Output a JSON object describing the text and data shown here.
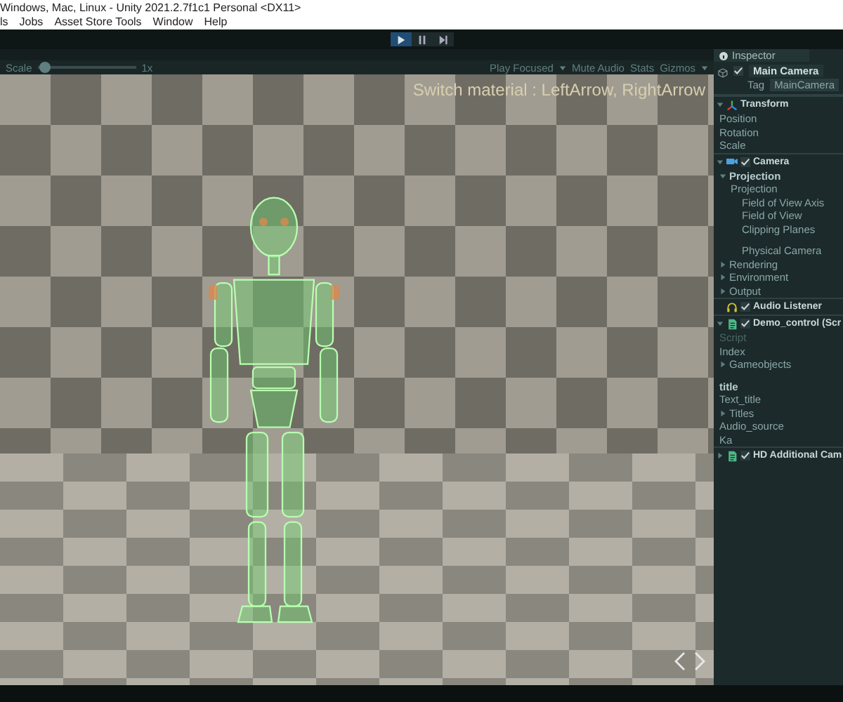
{
  "window": {
    "title": "Windows, Mac, Linux - Unity 2021.2.7f1c1 Personal <DX11>"
  },
  "menu": [
    "ls",
    "Jobs",
    "Asset Store Tools",
    "Window",
    "Help"
  ],
  "playback": [
    {
      "kind": "play",
      "selected": true
    },
    {
      "kind": "pause",
      "selected": false
    },
    {
      "kind": "step",
      "selected": false
    }
  ],
  "game_bar": {
    "scale_label": "Scale",
    "scale": {
      "level": 0.02
    },
    "scale_value": "1x",
    "play_mode": "Play Focused",
    "mute": "Mute Audio",
    "stats": "Stats",
    "gizmos": "Gizmos"
  },
  "game_view": {
    "hint": "Switch material : LeftArrow, RightArrow"
  },
  "inspector": {
    "tab": "Inspector",
    "object": {
      "name": "Main Camera",
      "active": true,
      "tag_label": "Tag",
      "tag": "MainCamera"
    },
    "rows": [
      {
        "kind": "transform",
        "title": "Transform",
        "expanded": true,
        "children": [
          {
            "kind": "field",
            "label": "Position"
          },
          {
            "kind": "field",
            "label": "Rotation"
          },
          {
            "kind": "field",
            "label": "Scale"
          }
        ]
      },
      {
        "kind": "camera",
        "title": "Camera",
        "checked": true,
        "expanded": true,
        "children": [
          {
            "kind": "foldout",
            "label": "Projection",
            "bold": true,
            "expanded": true,
            "children": [
              {
                "kind": "field",
                "label": "Projection",
                "children": [
                  {
                    "kind": "field",
                    "label": "Field of View Axis"
                  },
                  {
                    "kind": "field",
                    "label": "Field of View"
                  },
                  {
                    "kind": "field",
                    "label": "Clipping Planes"
                  },
                  {
                    "kind": "spacer"
                  },
                  {
                    "kind": "field",
                    "label": "Physical Camera"
                  }
                ]
              }
            ]
          },
          {
            "kind": "foldout",
            "label": "Rendering",
            "expanded": false
          },
          {
            "kind": "foldout",
            "label": "Environment",
            "expanded": false
          },
          {
            "kind": "foldout",
            "label": "Output",
            "expanded": false
          }
        ]
      },
      {
        "kind": "audio",
        "title": "Audio Listener",
        "checked": true
      },
      {
        "kind": "script",
        "title": "Demo_control (Scr",
        "checked": true,
        "expanded": true,
        "children": [
          {
            "kind": "field",
            "label": "Script",
            "disabled": true
          },
          {
            "kind": "field",
            "label": "Index"
          },
          {
            "kind": "foldout",
            "label": "Gameobjects",
            "expanded": false
          },
          {
            "kind": "spacer"
          },
          {
            "kind": "field",
            "label": "title",
            "bold": true
          },
          {
            "kind": "field",
            "label": "Text_title"
          },
          {
            "kind": "foldout",
            "label": "Titles",
            "expanded": false
          },
          {
            "kind": "field",
            "label": "Audio_source"
          },
          {
            "kind": "field",
            "label": "Ka"
          }
        ]
      },
      {
        "kind": "script",
        "title": "HD Additional Cam",
        "checked": true,
        "expanded": false
      }
    ]
  }
}
